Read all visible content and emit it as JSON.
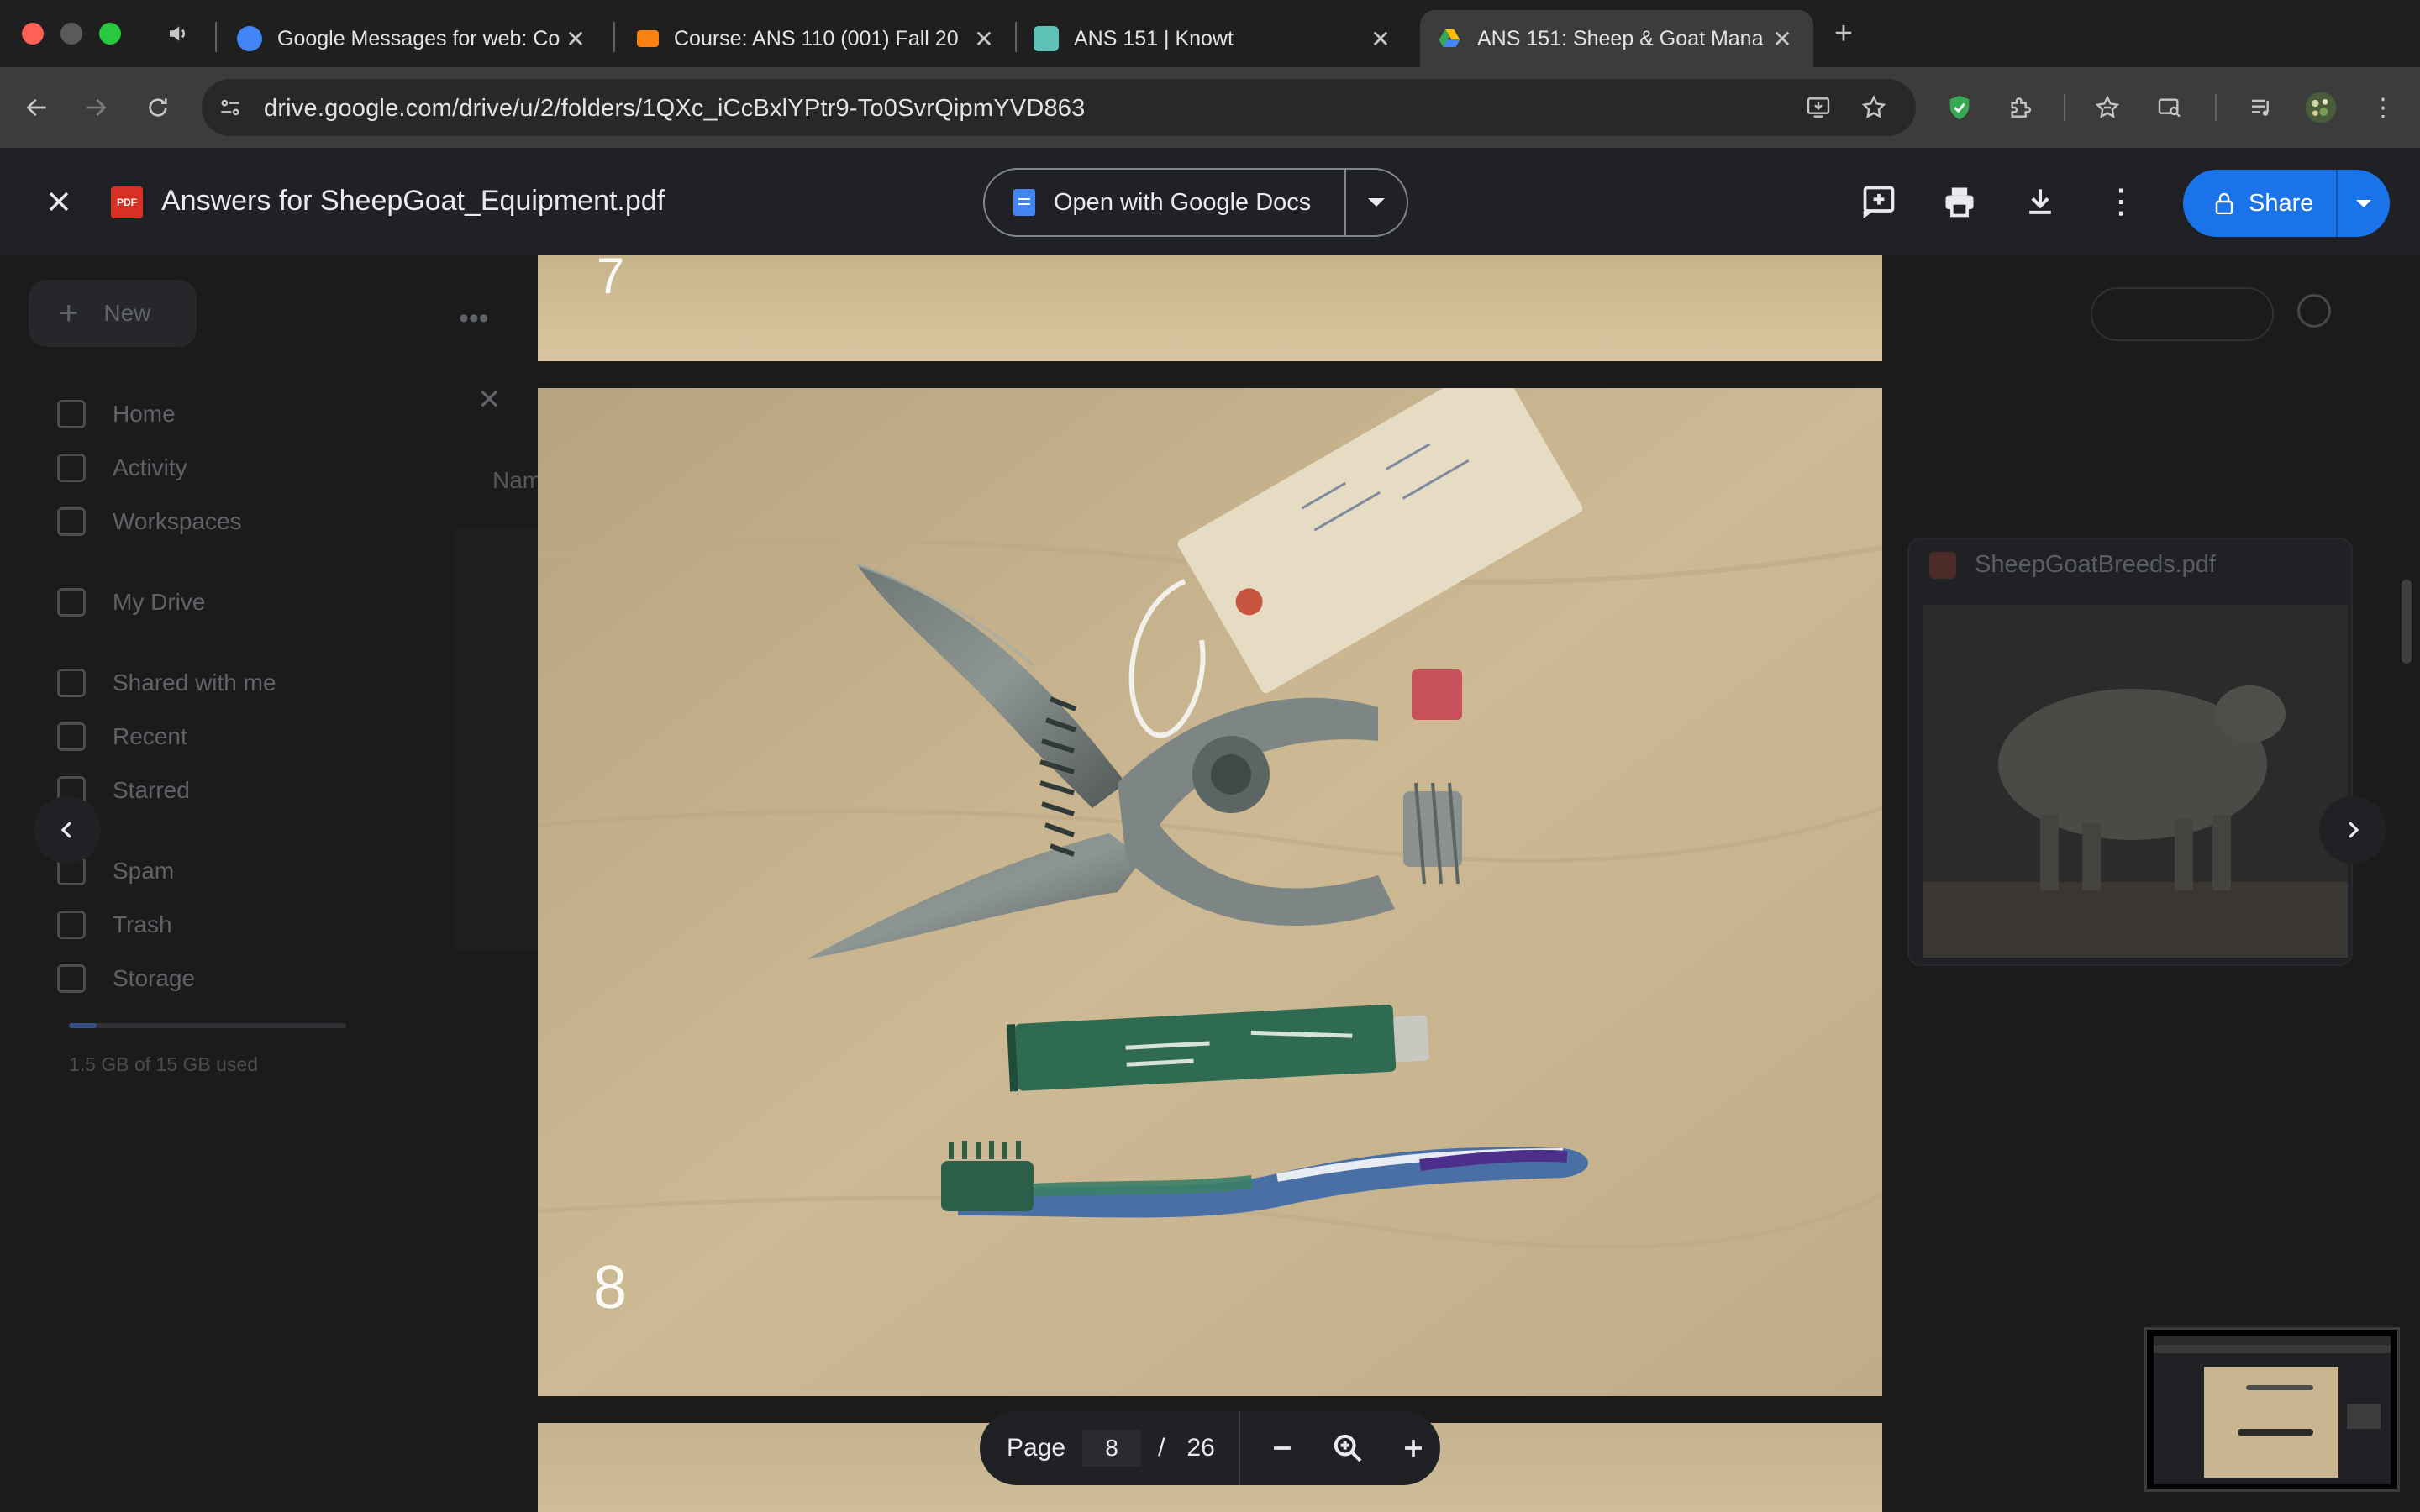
{
  "browser": {
    "tabs": [
      {
        "title": "Google Messages for web: Co",
        "favicon": "google-messages-icon",
        "active": false
      },
      {
        "title": "Course: ANS 110 (001) Fall 20",
        "favicon": "moodle-icon",
        "active": false
      },
      {
        "title": "ANS 151 | Knowt",
        "favicon": "knowt-icon",
        "active": false
      },
      {
        "title": "ANS 151: Sheep & Goat Mana",
        "favicon": "google-drive-icon",
        "active": true
      }
    ],
    "url": "drive.google.com/drive/u/2/folders/1QXc_iCcBxlYPtr9-To0SvrQipmYVD863"
  },
  "drive_background": {
    "new_label": "New",
    "sidebar": [
      {
        "label": "Home",
        "icon": "home-icon"
      },
      {
        "label": "Activity",
        "icon": "bell-icon"
      },
      {
        "label": "Workspaces",
        "icon": "workspaces-icon"
      },
      {
        "label": "My Drive",
        "icon": "drive-icon"
      },
      {
        "label": "Shared with me",
        "icon": "people-icon"
      },
      {
        "label": "Recent",
        "icon": "clock-icon"
      },
      {
        "label": "Starred",
        "icon": "star-icon"
      },
      {
        "label": "Spam",
        "icon": "spam-icon"
      },
      {
        "label": "Trash",
        "icon": "trash-icon"
      },
      {
        "label": "Storage",
        "icon": "cloud-icon"
      }
    ],
    "storage_text": "1.5 GB of 15 GB used",
    "storage_fraction": 0.1,
    "column_header": "Nam",
    "right_file_title": "SheepGoatBreeds.pdf"
  },
  "viewer": {
    "file_name": "Answers for SheepGoat_Equipment.pdf",
    "file_badge": "PDF",
    "open_with_label": "Open with Google Docs",
    "share_label": "Share",
    "current_page_number_mark": "8",
    "prev_page_mark": "7",
    "page_label": "Page",
    "current_page": "8",
    "separator": "/",
    "total_pages": "26"
  },
  "colors": {
    "accent": "#1a73e8",
    "pdf_red": "#d93025",
    "background": "#202124"
  }
}
